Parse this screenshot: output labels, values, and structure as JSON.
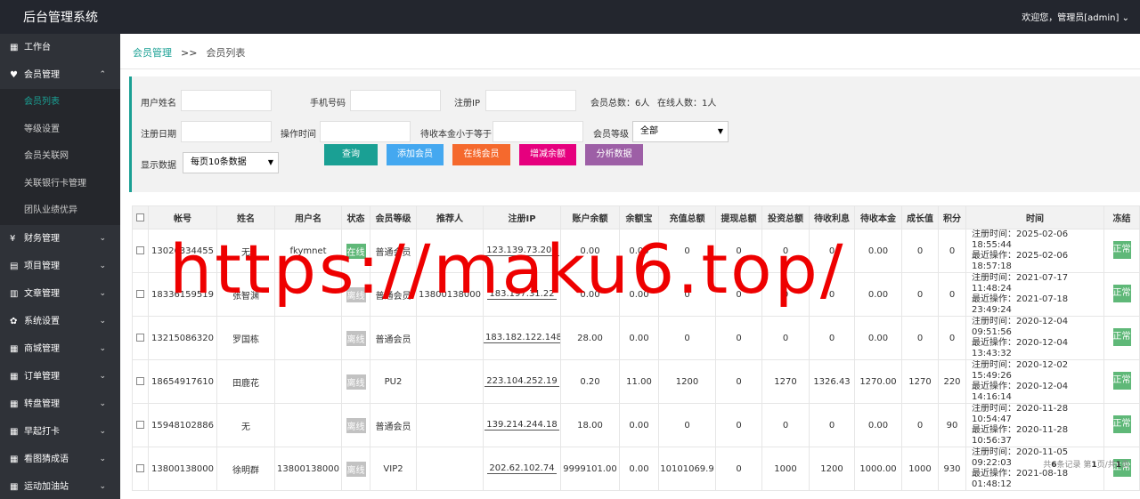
{
  "app": {
    "title": "后台管理系统",
    "user": "欢迎您，管理员[admin]"
  },
  "sidebar": {
    "items": [
      {
        "label": "工作台",
        "icon": "dashboard-icon",
        "glyph": "▦",
        "chevron": ""
      },
      {
        "label": "会员管理",
        "icon": "member-icon",
        "glyph": "♥",
        "chevron": "⌃",
        "expanded": true
      },
      {
        "label": "财务管理",
        "icon": "finance-icon",
        "glyph": "¥",
        "chevron": "⌄"
      },
      {
        "label": "项目管理",
        "icon": "project-icon",
        "glyph": "▤",
        "chevron": "⌄"
      },
      {
        "label": "文章管理",
        "icon": "article-icon",
        "glyph": "▥",
        "chevron": "⌄"
      },
      {
        "label": "系统设置",
        "icon": "gear-icon",
        "glyph": "✿",
        "chevron": "⌄"
      },
      {
        "label": "商城管理",
        "icon": "shop-icon",
        "glyph": "▦",
        "chevron": "⌄"
      },
      {
        "label": "订单管理",
        "icon": "order-icon",
        "glyph": "▦",
        "chevron": "⌄"
      },
      {
        "label": "转盘管理",
        "icon": "wheel-icon",
        "glyph": "▦",
        "chevron": "⌄"
      },
      {
        "label": "早起打卡",
        "icon": "checkin-icon",
        "glyph": "▦",
        "chevron": "⌄"
      },
      {
        "label": "看图猜成语",
        "icon": "puzzle-icon",
        "glyph": "▦",
        "chevron": "⌄"
      },
      {
        "label": "运动加油站",
        "icon": "sport-icon",
        "glyph": "▦",
        "chevron": "⌄"
      }
    ],
    "subitems": [
      "会员列表",
      "等级设置",
      "会员关联网",
      "关联银行卡管理",
      "团队业绩优异"
    ]
  },
  "breadcrumb": {
    "parent": "会员管理",
    "sep": ">>",
    "current": "会员列表"
  },
  "filters": {
    "username_label": "用户姓名",
    "phone_label": "手机号码",
    "ip_label": "注册IP",
    "total_members": "会员总数：6人",
    "online_count": "在线人数：1人",
    "reg_date_label": "注册日期",
    "op_time_label": "操作时间",
    "pending_label": "待收本金小于等于",
    "level_label": "会员等级",
    "level_value": "全部",
    "display_label": "显示数据",
    "display_value": "每页10条数据"
  },
  "buttons": {
    "query": "查询",
    "add": "添加会员",
    "online": "在线会员",
    "balance": "增减余额",
    "analyze": "分析数据",
    "colors": {
      "query": "#1aa094",
      "add": "#44a8f0",
      "online": "#f5692d",
      "balance": "#e6007e",
      "analyze": "#9d5fa6"
    }
  },
  "table": {
    "headers": [
      "帐号",
      "姓名",
      "用户名",
      "状态",
      "会员等级",
      "推荐人",
      "注册IP",
      "账户余额",
      "余额宝",
      "充值总额",
      "提现总额",
      "投资总额",
      "待收利息",
      "待收本金",
      "成长值",
      "积分",
      "时间",
      "冻结"
    ],
    "rows": [
      {
        "account": "13026334455",
        "name": "无",
        "username": "fkymnet",
        "status": "在线",
        "online": true,
        "level": "普通会员",
        "referrer": "",
        "ip": "123.139.73.203",
        "balance": "0.00",
        "yuebao": "0.00",
        "recharge": "0",
        "withdraw": "0",
        "invest": "0",
        "interest": "0",
        "principal": "0.00",
        "growth": "0",
        "points": "0",
        "reg_time": "注册时间：2025-02-06 18:55:44",
        "last_op": "最近操作：2025-02-06 18:57:18",
        "freeze": "正常"
      },
      {
        "account": "18336159519",
        "name": "张智渊",
        "username": "",
        "status": "离线",
        "online": false,
        "level": "普通会员",
        "referrer": "13800138000",
        "ip": "183.197.31.22",
        "balance": "0.00",
        "yuebao": "0.00",
        "recharge": "0",
        "withdraw": "0",
        "invest": "0",
        "interest": "0",
        "principal": "0.00",
        "growth": "0",
        "points": "0",
        "reg_time": "注册时间：2021-07-17 11:48:24",
        "last_op": "最近操作：2021-07-18 23:49:24",
        "freeze": "正常"
      },
      {
        "account": "13215086320",
        "name": "罗国栋",
        "username": "",
        "status": "离线",
        "online": false,
        "level": "普通会员",
        "referrer": "",
        "ip": "183.182.122.148",
        "balance": "28.00",
        "yuebao": "0.00",
        "recharge": "0",
        "withdraw": "0",
        "invest": "0",
        "interest": "0",
        "principal": "0.00",
        "growth": "0",
        "points": "0",
        "reg_time": "注册时间：2020-12-04 09:51:56",
        "last_op": "最近操作：2020-12-04 13:43:32",
        "freeze": "正常"
      },
      {
        "account": "18654917610",
        "name": "田鹿花",
        "username": "",
        "status": "离线",
        "online": false,
        "level": "PU2",
        "referrer": "",
        "ip": "223.104.252.19",
        "balance": "0.20",
        "yuebao": "11.00",
        "recharge": "1200",
        "withdraw": "0",
        "invest": "1270",
        "interest": "1326.43",
        "principal": "1270.00",
        "growth": "1270",
        "points": "220",
        "reg_time": "注册时间：2020-12-02 15:49:26",
        "last_op": "最近操作：2020-12-04 14:16:14",
        "freeze": "正常"
      },
      {
        "account": "15948102886",
        "name": "无",
        "username": "",
        "status": "离线",
        "online": false,
        "level": "普通会员",
        "referrer": "",
        "ip": "139.214.244.18",
        "balance": "18.00",
        "yuebao": "0.00",
        "recharge": "0",
        "withdraw": "0",
        "invest": "0",
        "interest": "0",
        "principal": "0.00",
        "growth": "0",
        "points": "90",
        "reg_time": "注册时间：2020-11-28 10:54:47",
        "last_op": "最近操作：2020-11-28 10:56:37",
        "freeze": "正常"
      },
      {
        "account": "13800138000",
        "name": "徐明群",
        "username": "13800138000",
        "status": "离线",
        "online": false,
        "level": "VIP2",
        "referrer": "",
        "ip": "202.62.102.74",
        "balance": "9999101.00",
        "yuebao": "0.00",
        "recharge": "10101069.9",
        "withdraw": "0",
        "invest": "1000",
        "interest": "1200",
        "principal": "1000.00",
        "growth": "1000",
        "points": "930",
        "reg_time": "注册时间：2020-11-05 09:22:03",
        "last_op": "最近操作：2021-08-18 01:48:12",
        "freeze": "正常"
      }
    ]
  },
  "pager": {
    "prefix": "共",
    "total": "6",
    "mid1": "条记录 第",
    "page": "1",
    "mid2": "页/共",
    "pages": "1",
    "suffix": "页"
  },
  "watermark": "https://maku6.top/"
}
